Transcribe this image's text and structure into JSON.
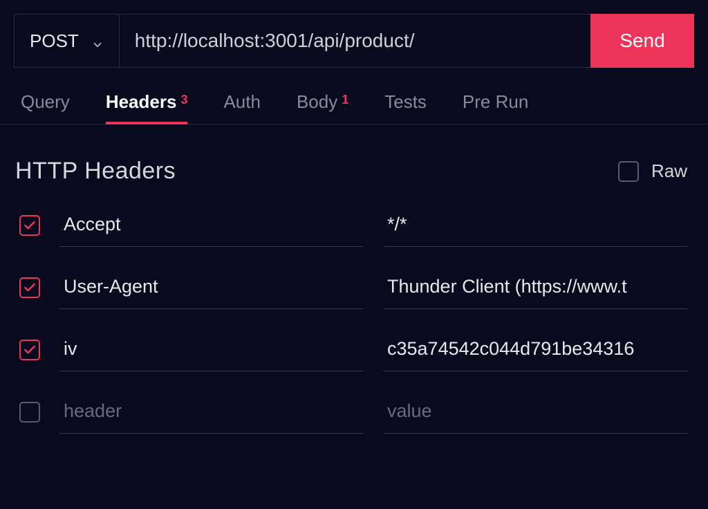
{
  "request": {
    "method": "POST",
    "url": "http://localhost:3001/api/product/",
    "send_label": "Send"
  },
  "tabs": {
    "query": {
      "label": "Query"
    },
    "headers": {
      "label": "Headers",
      "badge": "3"
    },
    "auth": {
      "label": "Auth"
    },
    "body": {
      "label": "Body",
      "badge": "1"
    },
    "tests": {
      "label": "Tests"
    },
    "prerun": {
      "label": "Pre Run"
    }
  },
  "headers_section": {
    "title": "HTTP Headers",
    "raw_label": "Raw",
    "name_placeholder": "header",
    "value_placeholder": "value",
    "rows": [
      {
        "enabled": true,
        "name": "Accept",
        "value": "*/*"
      },
      {
        "enabled": true,
        "name": "User-Agent",
        "value": "Thunder Client (https://www.t"
      },
      {
        "enabled": true,
        "name": "iv",
        "value": "c35a74542c044d791be34316"
      },
      {
        "enabled": false,
        "name": "",
        "value": ""
      }
    ]
  },
  "colors": {
    "accent": "#ed3459",
    "bg": "#0a0a1f"
  }
}
